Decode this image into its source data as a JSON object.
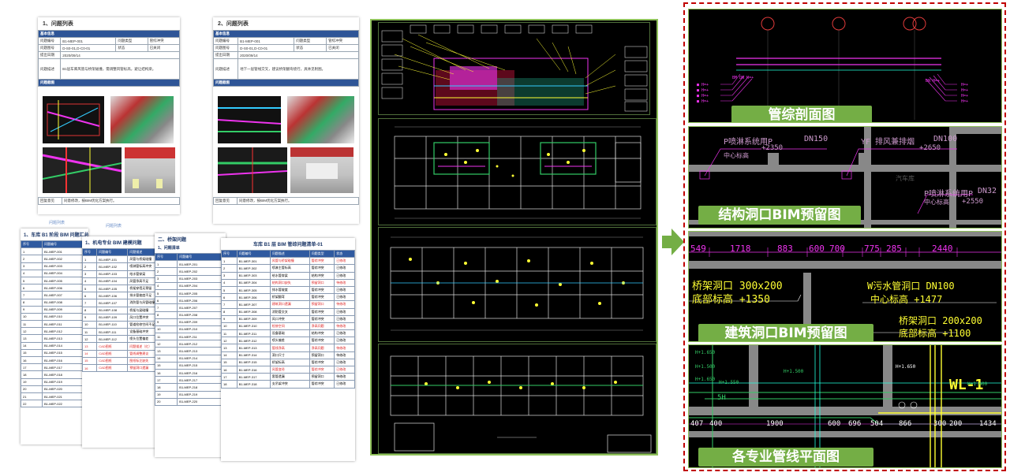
{
  "doc_pages": {
    "page1_title": "1、问题列表",
    "page2_title": "2、问题列表",
    "section_basic": "基本信息",
    "rows": [
      [
        "问题编号",
        "B1-MEP-001",
        "问题类型",
        "管综冲突"
      ],
      [
        "问题图号",
        "D-S0-01,D-C0-01",
        "状态",
        "已关闭"
      ]
    ],
    "row_date_label": "提出日期",
    "row_date_value": "2020/09/14",
    "row_desc_label": "问题描述",
    "row_desc_value": "B1层车库风管与桥架碰撞，需调整风管标高，避让结构梁。",
    "section_images": "问题截图",
    "row_reply_label": "回复意见",
    "row_reply_value": "同意修改，按BIM优化方案执行。",
    "page2_desc": "地下一层管线交叉，建议桥架翻弯绕行，具体见附图。",
    "tab_text": "问题列表",
    "tab_text2": "问题列表"
  },
  "list_pages": [
    {
      "title": "1、车库 B1 阶段 BIM 问题汇总",
      "header": [
        "序号",
        "问题编号"
      ],
      "rows": [
        [
          "1",
          "B1-MEP-001"
        ],
        [
          "2",
          "B1-MEP-002"
        ],
        [
          "3",
          "B1-MEP-003"
        ],
        [
          "4",
          "B1-MEP-004"
        ],
        [
          "5",
          "B1-MEP-005"
        ],
        [
          "6",
          "B1-MEP-006"
        ],
        [
          "7",
          "B1-MEP-007"
        ],
        [
          "8",
          "B1-MEP-008"
        ],
        [
          "9",
          "B1-MEP-009"
        ],
        [
          "10",
          "B1-MEP-010"
        ],
        [
          "11",
          "B1-MEP-011"
        ],
        [
          "12",
          "B1-MEP-012"
        ],
        [
          "13",
          "B1-MEP-013"
        ],
        [
          "14",
          "B1-MEP-014"
        ],
        [
          "15",
          "B1-MEP-015"
        ],
        [
          "16",
          "B1-MEP-016"
        ],
        [
          "17",
          "B1-MEP-017"
        ],
        [
          "18",
          "B1-MEP-018"
        ],
        [
          "19",
          "B1-MEP-019"
        ],
        [
          "20",
          "B1-MEP-020"
        ],
        [
          "21",
          "B1-MEP-021"
        ],
        [
          "22",
          "B1-MEP-022"
        ]
      ]
    },
    {
      "title": "1、机电专业 BIM 建模问题",
      "header": [
        "序号",
        "问题编号",
        "问题描述"
      ],
      "rows": [
        [
          "1",
          "B1-MEP-101",
          "风管与桥架碰撞"
        ],
        [
          "2",
          "B1-MEP-102",
          "喷淋管标高冲突"
        ],
        [
          "3",
          "B1-MEP-103",
          "给水管穿梁"
        ],
        [
          "4",
          "B1-MEP-104",
          "风管净高不足"
        ],
        [
          "5",
          "B1-MEP-105",
          "桥架穿墙无预留"
        ],
        [
          "6",
          "B1-MEP-106",
          "排水管坡度不足"
        ],
        [
          "7",
          "B1-MEP-107",
          "消防管与风管碰撞"
        ],
        [
          "8",
          "B1-MEP-108",
          "桥架与梁碰撞"
        ],
        [
          "9",
          "B1-MEP-109",
          "风口位置冲突"
        ],
        [
          "10",
          "B1-MEP-110",
          "管道检修空间不足"
        ],
        [
          "11",
          "B1-MEP-111",
          "设备基础冲突"
        ],
        [
          "12",
          "B1-MEP-112",
          "喷头位置偏差"
        ],
        [
          "13",
          "CAD图纸",
          "问题描述（红）"
        ],
        [
          "14",
          "CAD图纸",
          "管线调整建议"
        ],
        [
          "15",
          "CAD图纸",
          "图纸标注缺失"
        ],
        [
          "16",
          "CAD图纸",
          "预留洞口遗漏"
        ]
      ]
    },
    {
      "title": "二、桥架问题",
      "subtitle": "1、问题清单",
      "header": [
        "序号",
        "问题编号"
      ],
      "rows": [
        [
          "1",
          "B1-MEP-201"
        ],
        [
          "2",
          "B1-MEP-202"
        ],
        [
          "3",
          "B1-MEP-203"
        ],
        [
          "4",
          "B1-MEP-204"
        ],
        [
          "5",
          "B1-MEP-205"
        ],
        [
          "6",
          "B1-MEP-206"
        ],
        [
          "7",
          "B1-MEP-207"
        ],
        [
          "8",
          "B1-MEP-208"
        ],
        [
          "9",
          "B1-MEP-209"
        ],
        [
          "10",
          "B1-MEP-210"
        ],
        [
          "11",
          "B1-MEP-211"
        ],
        [
          "12",
          "B1-MEP-212"
        ],
        [
          "13",
          "B1-MEP-213"
        ],
        [
          "14",
          "B1-MEP-214"
        ],
        [
          "15",
          "B1-MEP-215"
        ],
        [
          "16",
          "B1-MEP-216"
        ],
        [
          "17",
          "B1-MEP-217"
        ],
        [
          "18",
          "B1-MEP-218"
        ],
        [
          "19",
          "B1-MEP-219"
        ],
        [
          "20",
          "B1-MEP-220"
        ]
      ]
    },
    {
      "title": "车库 B1 层 BIM 管综问题清单-01",
      "header": [
        "序号",
        "问题编号",
        "问题描述",
        "问题类型",
        "状态"
      ],
      "rows": [
        [
          "1",
          "B1-MEP-301",
          "风管与桥架碰撞",
          "管综冲突",
          "已修改"
        ],
        [
          "2",
          "B1-MEP-302",
          "喷淋主管标高",
          "管综冲突",
          "已修改"
        ],
        [
          "3",
          "B1-MEP-303",
          "给水管穿梁",
          "结构冲突",
          "已修改"
        ],
        [
          "4",
          "B1-MEP-304",
          "结构洞口缺失",
          "预留洞口",
          "待修改"
        ],
        [
          "5",
          "B1-MEP-305",
          "排水管坡度",
          "管综冲突",
          "已修改"
        ],
        [
          "6",
          "B1-MEP-306",
          "桥架翻弯",
          "管综冲突",
          "已修改"
        ],
        [
          "7",
          "B1-MEP-307",
          "建筑洞口遗漏",
          "预留洞口",
          "待修改"
        ],
        [
          "8",
          "B1-MEP-308",
          "消防管交叉",
          "管综冲突",
          "已修改"
        ],
        [
          "9",
          "B1-MEP-309",
          "风口冲突",
          "管综冲突",
          "已修改"
        ],
        [
          "10",
          "B1-MEP-310",
          "检修空间",
          "净高问题",
          "待修改"
        ],
        [
          "11",
          "B1-MEP-311",
          "设备基础",
          "结构冲突",
          "已修改"
        ],
        [
          "12",
          "B1-MEP-312",
          "喷头偏差",
          "管综冲突",
          "已修改"
        ],
        [
          "13",
          "B1-MEP-313",
          "管线净高",
          "净高问题",
          "待修改"
        ],
        [
          "14",
          "B1-MEP-314",
          "洞口尺寸",
          "预留洞口",
          "待修改"
        ],
        [
          "15",
          "B1-MEP-315",
          "桥架标高",
          "管综冲突",
          "已修改"
        ],
        [
          "16",
          "B1-MEP-316",
          "风管变径",
          "管综冲突",
          "已修改"
        ],
        [
          "17",
          "B1-MEP-317",
          "套管遗漏",
          "预留洞口",
          "待修改"
        ],
        [
          "18",
          "B1-MEP-318",
          "支吊架冲突",
          "管综冲突",
          "已修改"
        ]
      ]
    }
  ],
  "right_panels": {
    "p1_label": "管综剖面图",
    "p2_label": "结构洞口BIM预留图",
    "p3_label": "建筑洞口BIM预留图",
    "p4_label": "各专业管线平面图",
    "p2_texts": [
      "P喷淋系统用P",
      "DN150",
      "YF 排风兼排烟",
      "DN100",
      "中心标高",
      "+2350",
      "+2650",
      "P喷淋系统用P",
      "DN32",
      "中心标高",
      "+2550",
      "汽车库"
    ],
    "p3_dims": [
      "549",
      "1718",
      "883",
      "600",
      "700",
      "775",
      "285",
      "2440"
    ],
    "p3_texts": [
      "桥架洞口  300x200",
      "底部标高  +1350",
      "W污水管洞口  DN100",
      "中心标高  +1477",
      "桥架洞口  200x200",
      "底部标高  +1100"
    ],
    "p4_dims": [
      "407",
      "400",
      "1900",
      "600",
      "696",
      "504",
      "866",
      "300",
      "200",
      "1434"
    ],
    "p4_texts": [
      "H+1.650",
      "H+1.500",
      "H+1.650",
      "H+1.550",
      "WL-1",
      "H+1.600",
      "H+1.650",
      "H+1.500",
      "5H"
    ]
  },
  "colors": {
    "label_green": "#74ae45",
    "frame_red": "#c00000",
    "cad_black": "#000000"
  }
}
